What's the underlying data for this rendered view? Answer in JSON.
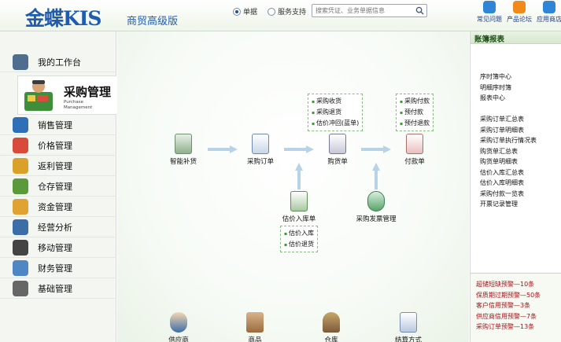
{
  "header": {
    "brand": "金蝶KIS",
    "brand_sub": "商贸高级版",
    "radio_single": "单据",
    "radio_service": "服务支持",
    "search_placeholder": "搜索凭证、业务单据信息",
    "icons": [
      {
        "label": "常见问题",
        "icon": "question-icon",
        "color": "#2f86d6"
      },
      {
        "label": "产品论坛",
        "icon": "forum-icon",
        "color": "#f08a1a"
      },
      {
        "label": "应用商店",
        "icon": "store-icon",
        "color": "#2f86d6"
      }
    ]
  },
  "sidebar": {
    "items": [
      {
        "label": "我的工作台",
        "icon": "monitor-icon",
        "color": "#4f6e8f"
      },
      {
        "label": "销售管理",
        "icon": "sales-icon",
        "color": "#2f6fb7"
      },
      {
        "label": "价格管理",
        "icon": "price-icon",
        "color": "#d84a3a"
      },
      {
        "label": "返利管理",
        "icon": "rebate-icon",
        "color": "#d9a12a"
      },
      {
        "label": "仓存管理",
        "icon": "warehouse-icon",
        "color": "#5a9a3a"
      },
      {
        "label": "资金管理",
        "icon": "money-icon",
        "color": "#e0a230"
      },
      {
        "label": "经营分析",
        "icon": "analysis-icon",
        "color": "#3b6ea8"
      },
      {
        "label": "移动管理",
        "icon": "mobile-icon",
        "color": "#444444"
      },
      {
        "label": "财务管理",
        "icon": "finance-icon",
        "color": "#4e87c4"
      },
      {
        "label": "基础管理",
        "icon": "basic-icon",
        "color": "#666666"
      }
    ],
    "active": {
      "label": "采购管理",
      "label_en": "Purchase Management",
      "icon": "purchase-icon"
    }
  },
  "flow": {
    "nodes": {
      "smart_replenish": "智能补货",
      "purchase_order": "采购订单",
      "purchase_receipt": "购货单",
      "payment": "付款单",
      "estimated_receipt": "估价入库单",
      "purchase_invoice": "采购发票管理"
    },
    "tips_receipt": [
      "采购收货",
      "采购退货",
      "估价冲回(蓝单)"
    ],
    "tips_payment": [
      "采购付款",
      "预付款",
      "预付退款"
    ],
    "tips_estimate": [
      "估价入库",
      "估价退货"
    ],
    "bottom": [
      "供应商",
      "商品",
      "仓库",
      "结算方式"
    ]
  },
  "right_panel": {
    "title": "账簿报表",
    "group1": [
      "序时簿中心",
      "明细序时簿",
      "报表中心"
    ],
    "group2": [
      "采购订单汇总表",
      "采购订单明细表",
      "采购订单执行情况表",
      "购货单汇总表",
      "购货单明细表",
      "估价入库汇总表",
      "估价入库明细表",
      "采购付款一览表",
      "开票记录管理"
    ],
    "warnings": [
      "超储短缺预警—10条",
      "保质期过期预警—50条",
      "客户信用预警—3条",
      "供应商信用预警—7条",
      "采购订单预警—13条"
    ]
  },
  "colors": {
    "accent": "#1f5cb0",
    "warning": "#a4121a",
    "arrow": "#b8d3e8"
  }
}
